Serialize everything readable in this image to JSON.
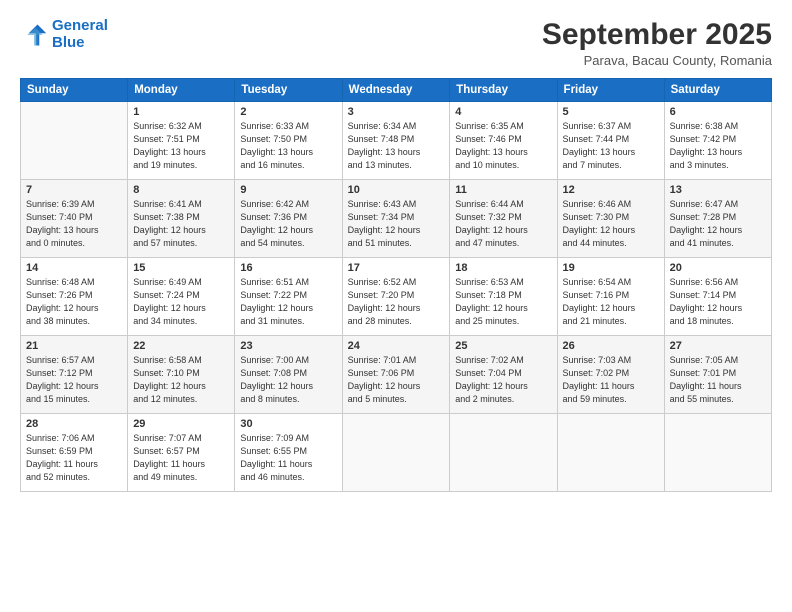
{
  "logo": {
    "line1": "General",
    "line2": "Blue"
  },
  "title": "September 2025",
  "subtitle": "Parava, Bacau County, Romania",
  "headers": [
    "Sunday",
    "Monday",
    "Tuesday",
    "Wednesday",
    "Thursday",
    "Friday",
    "Saturday"
  ],
  "weeks": [
    [
      {
        "day": "",
        "info": ""
      },
      {
        "day": "1",
        "info": "Sunrise: 6:32 AM\nSunset: 7:51 PM\nDaylight: 13 hours\nand 19 minutes."
      },
      {
        "day": "2",
        "info": "Sunrise: 6:33 AM\nSunset: 7:50 PM\nDaylight: 13 hours\nand 16 minutes."
      },
      {
        "day": "3",
        "info": "Sunrise: 6:34 AM\nSunset: 7:48 PM\nDaylight: 13 hours\nand 13 minutes."
      },
      {
        "day": "4",
        "info": "Sunrise: 6:35 AM\nSunset: 7:46 PM\nDaylight: 13 hours\nand 10 minutes."
      },
      {
        "day": "5",
        "info": "Sunrise: 6:37 AM\nSunset: 7:44 PM\nDaylight: 13 hours\nand 7 minutes."
      },
      {
        "day": "6",
        "info": "Sunrise: 6:38 AM\nSunset: 7:42 PM\nDaylight: 13 hours\nand 3 minutes."
      }
    ],
    [
      {
        "day": "7",
        "info": "Sunrise: 6:39 AM\nSunset: 7:40 PM\nDaylight: 13 hours\nand 0 minutes."
      },
      {
        "day": "8",
        "info": "Sunrise: 6:41 AM\nSunset: 7:38 PM\nDaylight: 12 hours\nand 57 minutes."
      },
      {
        "day": "9",
        "info": "Sunrise: 6:42 AM\nSunset: 7:36 PM\nDaylight: 12 hours\nand 54 minutes."
      },
      {
        "day": "10",
        "info": "Sunrise: 6:43 AM\nSunset: 7:34 PM\nDaylight: 12 hours\nand 51 minutes."
      },
      {
        "day": "11",
        "info": "Sunrise: 6:44 AM\nSunset: 7:32 PM\nDaylight: 12 hours\nand 47 minutes."
      },
      {
        "day": "12",
        "info": "Sunrise: 6:46 AM\nSunset: 7:30 PM\nDaylight: 12 hours\nand 44 minutes."
      },
      {
        "day": "13",
        "info": "Sunrise: 6:47 AM\nSunset: 7:28 PM\nDaylight: 12 hours\nand 41 minutes."
      }
    ],
    [
      {
        "day": "14",
        "info": "Sunrise: 6:48 AM\nSunset: 7:26 PM\nDaylight: 12 hours\nand 38 minutes."
      },
      {
        "day": "15",
        "info": "Sunrise: 6:49 AM\nSunset: 7:24 PM\nDaylight: 12 hours\nand 34 minutes."
      },
      {
        "day": "16",
        "info": "Sunrise: 6:51 AM\nSunset: 7:22 PM\nDaylight: 12 hours\nand 31 minutes."
      },
      {
        "day": "17",
        "info": "Sunrise: 6:52 AM\nSunset: 7:20 PM\nDaylight: 12 hours\nand 28 minutes."
      },
      {
        "day": "18",
        "info": "Sunrise: 6:53 AM\nSunset: 7:18 PM\nDaylight: 12 hours\nand 25 minutes."
      },
      {
        "day": "19",
        "info": "Sunrise: 6:54 AM\nSunset: 7:16 PM\nDaylight: 12 hours\nand 21 minutes."
      },
      {
        "day": "20",
        "info": "Sunrise: 6:56 AM\nSunset: 7:14 PM\nDaylight: 12 hours\nand 18 minutes."
      }
    ],
    [
      {
        "day": "21",
        "info": "Sunrise: 6:57 AM\nSunset: 7:12 PM\nDaylight: 12 hours\nand 15 minutes."
      },
      {
        "day": "22",
        "info": "Sunrise: 6:58 AM\nSunset: 7:10 PM\nDaylight: 12 hours\nand 12 minutes."
      },
      {
        "day": "23",
        "info": "Sunrise: 7:00 AM\nSunset: 7:08 PM\nDaylight: 12 hours\nand 8 minutes."
      },
      {
        "day": "24",
        "info": "Sunrise: 7:01 AM\nSunset: 7:06 PM\nDaylight: 12 hours\nand 5 minutes."
      },
      {
        "day": "25",
        "info": "Sunrise: 7:02 AM\nSunset: 7:04 PM\nDaylight: 12 hours\nand 2 minutes."
      },
      {
        "day": "26",
        "info": "Sunrise: 7:03 AM\nSunset: 7:02 PM\nDaylight: 11 hours\nand 59 minutes."
      },
      {
        "day": "27",
        "info": "Sunrise: 7:05 AM\nSunset: 7:01 PM\nDaylight: 11 hours\nand 55 minutes."
      }
    ],
    [
      {
        "day": "28",
        "info": "Sunrise: 7:06 AM\nSunset: 6:59 PM\nDaylight: 11 hours\nand 52 minutes."
      },
      {
        "day": "29",
        "info": "Sunrise: 7:07 AM\nSunset: 6:57 PM\nDaylight: 11 hours\nand 49 minutes."
      },
      {
        "day": "30",
        "info": "Sunrise: 7:09 AM\nSunset: 6:55 PM\nDaylight: 11 hours\nand 46 minutes."
      },
      {
        "day": "",
        "info": ""
      },
      {
        "day": "",
        "info": ""
      },
      {
        "day": "",
        "info": ""
      },
      {
        "day": "",
        "info": ""
      }
    ]
  ]
}
